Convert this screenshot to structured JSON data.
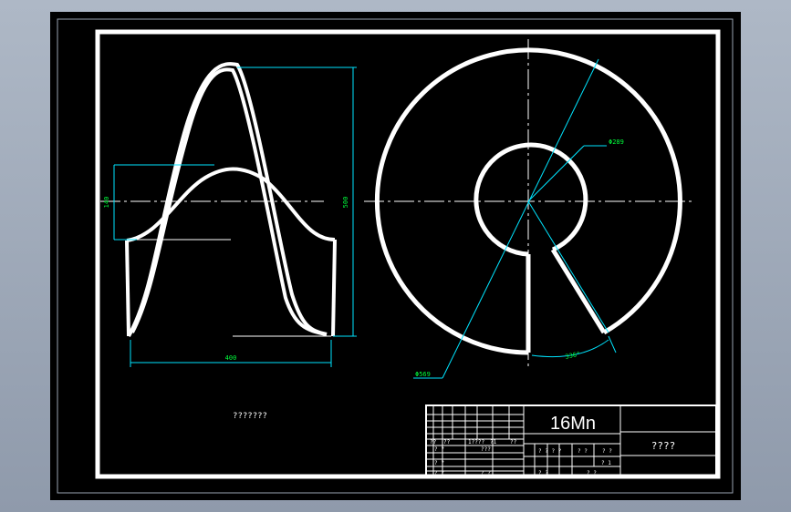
{
  "drawing": {
    "dim_height_left": "140",
    "dim_height_right": "500",
    "dim_width": "400",
    "dim_dia_inner": "Φ289",
    "dim_dia_outer": "Φ569",
    "dim_angle": "336°",
    "note_text": "???????"
  },
  "title_block": {
    "material": "16Mn",
    "drawing_name": "????",
    "cells": {
      "r6_c1": "??",
      "r6_c2": "??",
      "r6_c3": "1????",
      "r6_c4": "?1",
      "r6_c5": "??",
      "r7_c1": "? ?",
      "r7_c2": "???",
      "r8_c1": "? ?",
      "r9_c1": "? ?",
      "r9_c2": "? ?",
      "stage": "? ? ? ?",
      "weight": "? ?",
      "scale": "? ?",
      "scale_val": "? 1",
      "sheet1": "?  ?",
      "sheet2": "?  ?"
    }
  },
  "colors": {
    "background": "#000000",
    "outline": "#ffffff",
    "dimension": "#00e5ff",
    "dimension_text": "#00ff3c",
    "frame_outer": "#a3adbb"
  }
}
